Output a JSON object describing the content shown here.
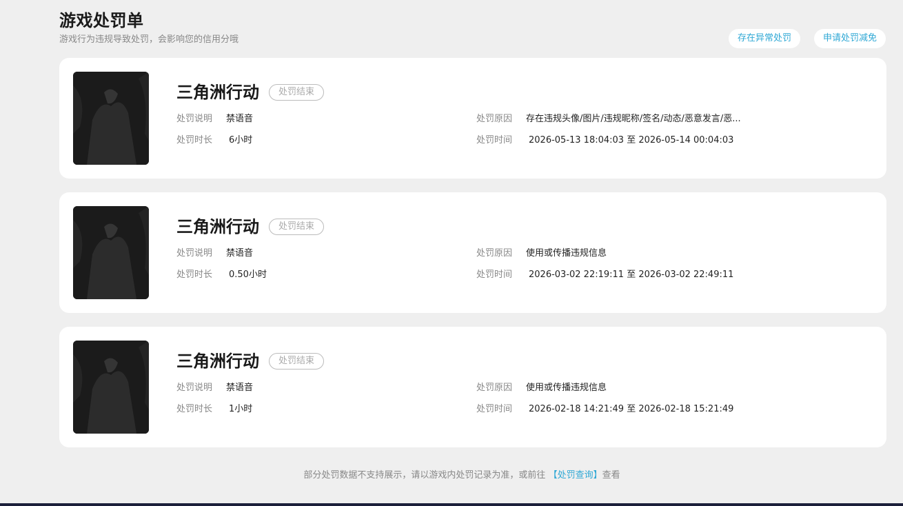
{
  "page": {
    "title": "游戏处罚单",
    "subtitle": "游戏行为违规导致处罚，会影响您的信用分哦"
  },
  "actions": {
    "abnormal_label": "存在异常处罚",
    "appeal_label": "申请处罚减免"
  },
  "labels": {
    "desc": "处罚说明",
    "duration": "处罚时长",
    "reason": "处罚原因",
    "time": "处罚时间"
  },
  "records": [
    {
      "game": "三角洲行动",
      "status": "处罚结束",
      "desc": "禁语音",
      "duration": "6小时",
      "reason": "存在违规头像/图片/违规昵称/签名/动态/恶意发言/恶...",
      "time": "2026-05-13 18:04:03 至 2026-05-14 00:04:03"
    },
    {
      "game": "三角洲行动",
      "status": "处罚结束",
      "desc": "禁语音",
      "duration": "0.50小时",
      "reason": "使用或传播违规信息",
      "time": "2026-03-02 22:19:11 至 2026-03-02 22:49:11"
    },
    {
      "game": "三角洲行动",
      "status": "处罚结束",
      "desc": "禁语音",
      "duration": "1小时",
      "reason": "使用或传播违规信息",
      "time": "2026-02-18 14:21:49 至 2026-02-18 15:21:49"
    }
  ],
  "footer": {
    "prefix": "部分处罚数据不支持展示，请以游戏内处罚记录为准，或前往",
    "link": "【处罚查询】",
    "suffix": "查看"
  },
  "colors": {
    "accent": "#2fa8d5",
    "background": "#efefef",
    "bottom_bar": "#1c1f3a"
  }
}
